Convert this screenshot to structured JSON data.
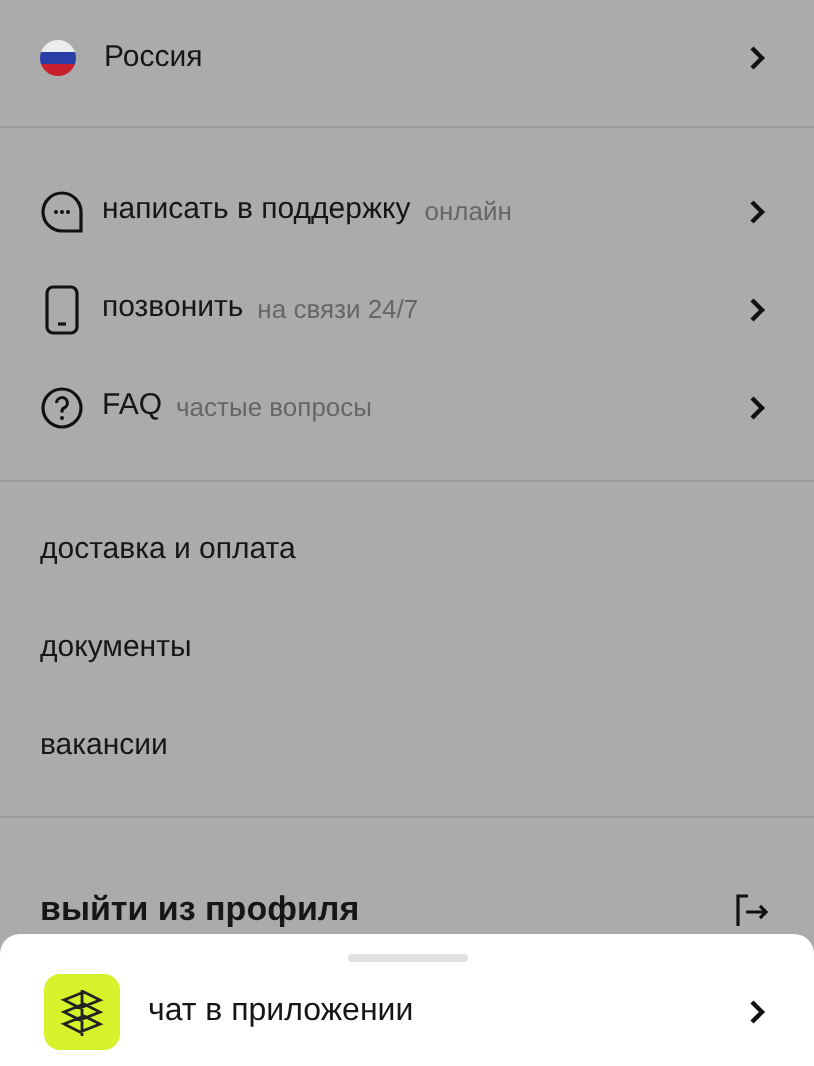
{
  "country": {
    "label": "Россия"
  },
  "contacts": [
    {
      "kind": "chat",
      "label": "написать в поддержку",
      "note": "онлайн"
    },
    {
      "kind": "phone",
      "label": "позвонить",
      "note": "на связи 24/7"
    },
    {
      "kind": "faq",
      "label": "FAQ",
      "note": "частые вопросы"
    }
  ],
  "links": [
    "доставка и оплата",
    "документы",
    "вакансии"
  ],
  "logout": {
    "label": "выйти из профиля"
  },
  "sheet": {
    "label": "чат в приложении"
  }
}
